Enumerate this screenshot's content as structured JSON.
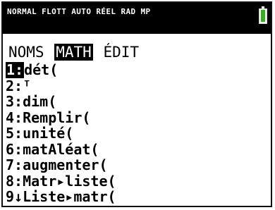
{
  "status_bar": {
    "modes": [
      "NORMAL",
      "FLOTT",
      "AUTO",
      "RÉEL",
      "RAD",
      "MP"
    ],
    "battery_color": "#35b21b",
    "battery_level": 0.85
  },
  "menu": {
    "tabs": [
      {
        "label": "NOMS",
        "active": false
      },
      {
        "label": "MATH",
        "active": true
      },
      {
        "label": "ÉDIT",
        "active": false
      }
    ],
    "items": [
      {
        "num": "1:",
        "label": "dét(",
        "selected": true
      },
      {
        "num": "2:",
        "label": "ᵀ",
        "selected": false
      },
      {
        "num": "3:",
        "label": "dim(",
        "selected": false
      },
      {
        "num": "4:",
        "label": "Remplir(",
        "selected": false
      },
      {
        "num": "5:",
        "label": "unité(",
        "selected": false
      },
      {
        "num": "6:",
        "label": "matAléat(",
        "selected": false
      },
      {
        "num": "7:",
        "label": "augmenter(",
        "selected": false
      },
      {
        "num": "8:",
        "label": "Matr▸liste(",
        "selected": false
      },
      {
        "num": "9↓",
        "label": "Liste▸matr(",
        "selected": false
      }
    ]
  }
}
